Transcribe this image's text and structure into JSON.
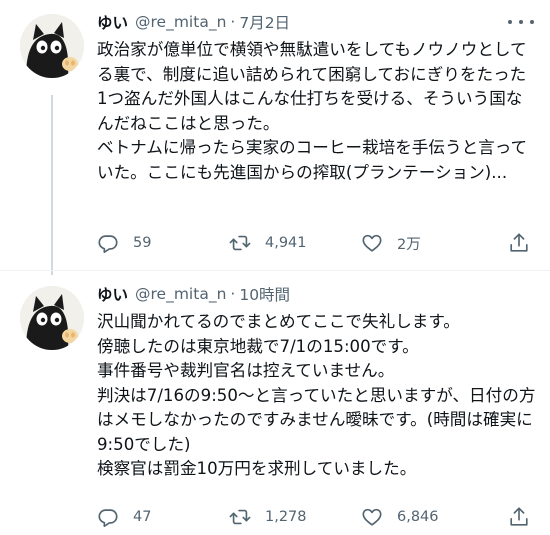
{
  "tweets": [
    {
      "name": "ゆい",
      "handle": "@re_mita_n",
      "separator": "·",
      "time": "7月2日",
      "text": "政治家が億単位で横領や無駄遣いをしてもノウノウとしてる裏で、制度に追い詰められて困窮しておにぎりをたった1つ盗んだ外国人はこんな仕打ちを受ける、そういう国なんだねここはと思った。\nベトナムに帰ったら実家のコーヒー栽培を手伝うと言っていた。ここにも先進国からの搾取(プランテーション)...",
      "replies": "59",
      "retweets": "4,941",
      "likes": "2万"
    },
    {
      "name": "ゆい",
      "handle": "@re_mita_n",
      "separator": "·",
      "time": "10時間",
      "text": "沢山聞かれてるのでまとめてここで失礼します。\n傍聴したのは東京地裁で7/1の15:00です。\n事件番号や裁判官名は控えていません。\n判決は7/16の9:50〜と言っていたと思いますが、日付の方はメモしなかったのですみません曖昧です。(時間は確実に9:50でした)\n検察官は罰金10万円を求刑していました。",
      "replies": "47",
      "retweets": "1,278",
      "likes": "6,846"
    }
  ],
  "icons": {
    "reply": "reply-icon",
    "retweet": "retweet-icon",
    "like": "heart-icon",
    "share": "share-icon",
    "more": "more-icon"
  },
  "colors": {
    "text": "#0f1419",
    "muted": "#536471",
    "thread_line": "#cfd9de"
  }
}
